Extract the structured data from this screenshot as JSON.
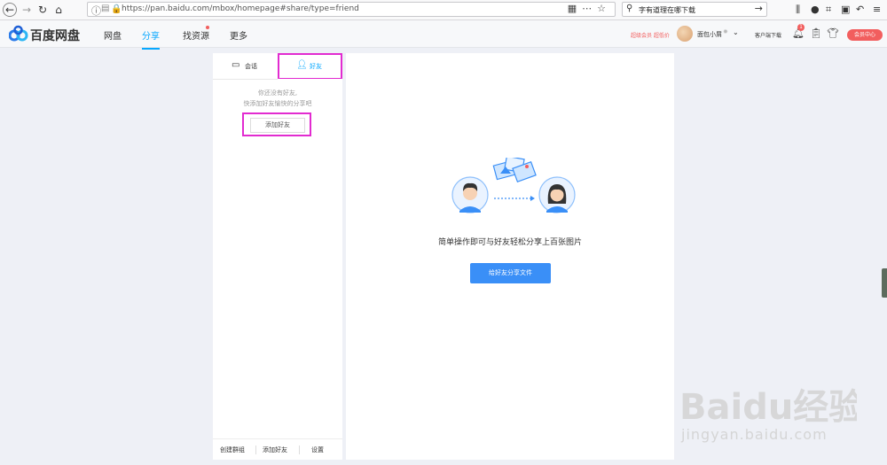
{
  "browser": {
    "url": "https://pan.baidu.com/mbox/homepage#share/type=friend",
    "search_text": "字有道理在哪下载"
  },
  "header": {
    "logo_text": "百度网盘",
    "nav": [
      {
        "label": "网盘"
      },
      {
        "label": "分享"
      },
      {
        "label": "找资源"
      },
      {
        "label": "更多"
      }
    ],
    "vip_link": "超级会员 超低价",
    "username": "面包小屑",
    "client_download": "客户端下载",
    "notification_count": "1",
    "vip_center": "会员中心"
  },
  "left_panel": {
    "tab_session": "会话",
    "tab_friends": "好友",
    "empty_line1": "你还没有好友,",
    "empty_line2": "快添加好友愉快的分享吧",
    "add_friend_button": "添加好友",
    "footer": {
      "create_group": "创建群组",
      "add_friend": "添加好友",
      "settings": "设置"
    }
  },
  "right_panel": {
    "caption": "简单操作即可与好友轻松分享上百张图片",
    "share_button": "给好友分享文件"
  },
  "watermark": {
    "brand": "Baidu经验",
    "url": "jingyan.baidu.com"
  },
  "colors": {
    "accent": "#06a7ff",
    "button_blue": "#3a8ff7",
    "vip_red": "#f25e5e",
    "highlight_magenta": "#e22bd0"
  }
}
